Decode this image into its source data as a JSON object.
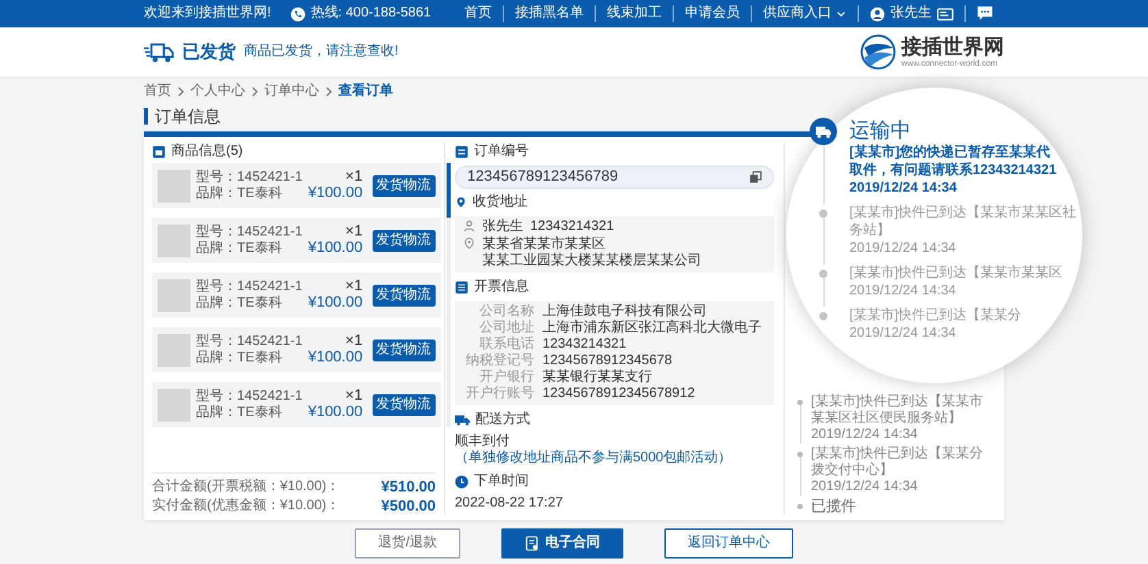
{
  "top_bar": {
    "welcome": "欢迎来到接插世界网!",
    "hotline": "热线: 400-188-5861",
    "nav": [
      {
        "kind": "link",
        "label": "首页"
      },
      {
        "kind": "link",
        "label": "接插黑名单"
      },
      {
        "kind": "link",
        "label": "线束加工"
      },
      {
        "kind": "link",
        "label": "申请会员"
      },
      {
        "kind": "dropdown",
        "label": "供应商入口"
      },
      {
        "kind": "user",
        "label": "张先生"
      },
      {
        "kind": "chat"
      }
    ]
  },
  "header": {
    "status": "已发货",
    "message": "商品已发货，请注意查收!",
    "logo_name": "接插世界网",
    "logo_url": "www.connector-world.com"
  },
  "breadcrumb": [
    {
      "label": "首页",
      "selected": false
    },
    {
      "label": "个人中心",
      "selected": false
    },
    {
      "label": "订单中心",
      "selected": false
    },
    {
      "label": "查看订单",
      "selected": true
    }
  ],
  "page_title": "订单信息",
  "products": {
    "title": "商品信息(5)",
    "items": [
      {
        "model": "型号：1452421-1",
        "brand": "品牌：TE泰科",
        "qty": "×1",
        "price": "¥100.00",
        "action": "发货物流"
      },
      {
        "model": "型号：1452421-1",
        "brand": "品牌：TE泰科",
        "qty": "×1",
        "price": "¥100.00",
        "action": "发货物流"
      },
      {
        "model": "型号：1452421-1",
        "brand": "品牌：TE泰科",
        "qty": "×1",
        "price": "¥100.00",
        "action": "发货物流"
      },
      {
        "model": "型号：1452421-1",
        "brand": "品牌：TE泰科",
        "qty": "×1",
        "price": "¥100.00",
        "action": "发货物流"
      },
      {
        "model": "型号：1452421-1",
        "brand": "品牌：TE泰科",
        "qty": "×1",
        "price": "¥100.00",
        "action": "发货物流"
      }
    ]
  },
  "totals": [
    {
      "label": "合计金额(开票税额：¥10.00)：",
      "value": "¥510.00"
    },
    {
      "label": "实付金额(优惠金额：¥10.00)：",
      "value": "¥500.00"
    }
  ],
  "order_number": {
    "title": "订单编号",
    "value": "123456789123456789"
  },
  "address": {
    "title": "收货地址",
    "name": "张先生",
    "phone": "12343214321",
    "lines": [
      "某某省某某市某某区",
      "某某工业园某大楼某某楼层某某公司"
    ]
  },
  "invoice": {
    "title": "开票信息",
    "rows": [
      {
        "label": "公司名称",
        "value": "上海佳鼓电子科技有限公司"
      },
      {
        "label": "公司地址",
        "value": "上海市浦东新区张江高科北大微电子"
      },
      {
        "label": "联系电话",
        "value": "12343214321"
      },
      {
        "label": "纳税登记号",
        "value": "12345678912345678"
      },
      {
        "label": "开户银行",
        "value": "某某银行某某支行"
      },
      {
        "label": "开户行账号",
        "value": "12345678912345678912"
      }
    ]
  },
  "shipping": {
    "title": "配送方式",
    "method": "顺丰到付",
    "note": "（单独修改地址商品不参与满5000包邮活动）"
  },
  "order_time": {
    "title": "下单时间",
    "value": "2022-08-22  17:27"
  },
  "tracking": {
    "magnified": [
      {
        "kind": "current",
        "status": "运输中",
        "lines": [
          "[某某市]您的快递已暂存至某某代",
          "取件，有问题请联系12343214321"
        ],
        "time": "2019/12/24 14:34"
      },
      {
        "kind": "past",
        "lines": [
          "[某某市]快件已到达【某某市某某区社",
          "务站】"
        ],
        "time": "2019/12/24 14:34"
      },
      {
        "kind": "past",
        "lines": [
          "[某某市]快件已到达【某某市某某区"
        ],
        "time": "2019/12/24 14:34"
      },
      {
        "kind": "past",
        "lines": [
          "[某某市]快件已到达【某某分"
        ],
        "time": "2019/12/24 14:34"
      }
    ],
    "events": [
      {
        "kind": "past",
        "lines": [
          "[某某市]快件已到达【某某市某某区社区便民服务站】"
        ],
        "time": "2019/12/24 14:34"
      },
      {
        "kind": "past",
        "lines": [
          "[某某市]快件已到达【某某分拨交付中心】"
        ],
        "time": "2019/12/24 14:34"
      },
      {
        "kind": "status",
        "status": "已揽件"
      }
    ]
  },
  "buttons": [
    {
      "kind": "secondary",
      "label": "退货/退款"
    },
    {
      "kind": "primary",
      "label": "电子合同"
    },
    {
      "kind": "outline",
      "label": "返回订单中心"
    }
  ]
}
